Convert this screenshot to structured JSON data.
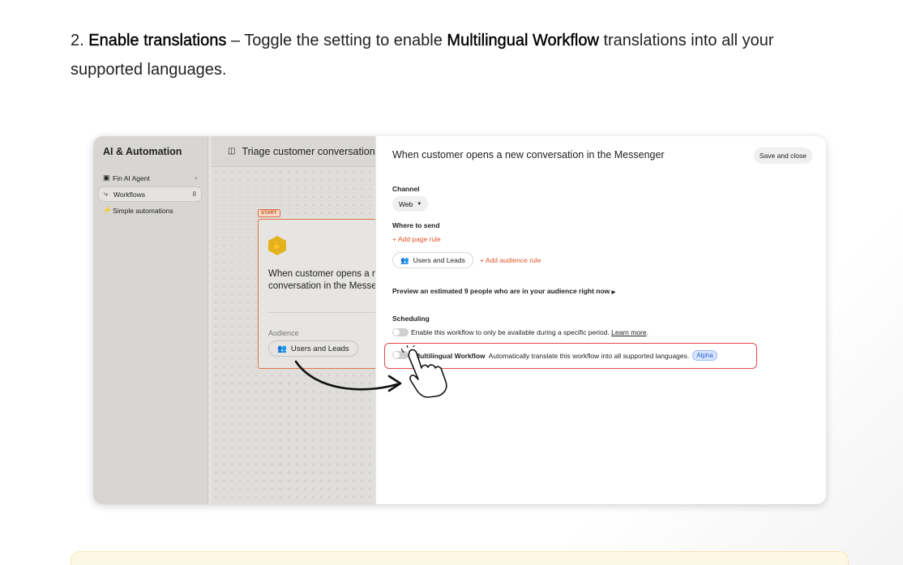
{
  "intro": {
    "number": "2.",
    "bold1": "Enable translations",
    "text1": " – Toggle the setting to enable ",
    "bold2": "Multilingual Workflow",
    "text2": " translations into all your supported languages."
  },
  "sidebar": {
    "title": "AI & Automation",
    "items": [
      {
        "label": "Fin AI Agent",
        "icon": "fin-icon",
        "right": "›"
      },
      {
        "label": "Workflows",
        "icon": "workflow-icon",
        "right": "8"
      },
      {
        "label": "Simple automations",
        "icon": "bolt-icon",
        "right": ""
      }
    ]
  },
  "canvas": {
    "header": "Triage customer conversations",
    "start_tag": "START",
    "card_title": "When customer opens a new conversation in the Messenger",
    "audience_label": "Audience",
    "audience_value": "Users and Leads"
  },
  "panel": {
    "title": "When customer opens a new conversation in the Messenger",
    "save_label": "Save and close",
    "channel_label": "Channel",
    "channel_value": "Web",
    "where_label": "Where to send",
    "add_page_rule": "+ Add page rule",
    "users_leads": "Users and Leads",
    "add_audience_rule": "+ Add audience rule",
    "preview": "Preview an estimated 9 people who are in your audience right now",
    "scheduling_label": "Scheduling",
    "schedule_text": "Enable this workflow to only be available during a specific period.",
    "learn_more": "Learn more",
    "ml_title": "Multilingual Workflow",
    "ml_desc": "Automatically translate this workflow into all supported languages.",
    "alpha": "Alpha"
  },
  "colors": {
    "accent_orange": "#e0562b",
    "highlight_red": "#e54a4a",
    "alpha_blue": "#2f5ec8"
  }
}
